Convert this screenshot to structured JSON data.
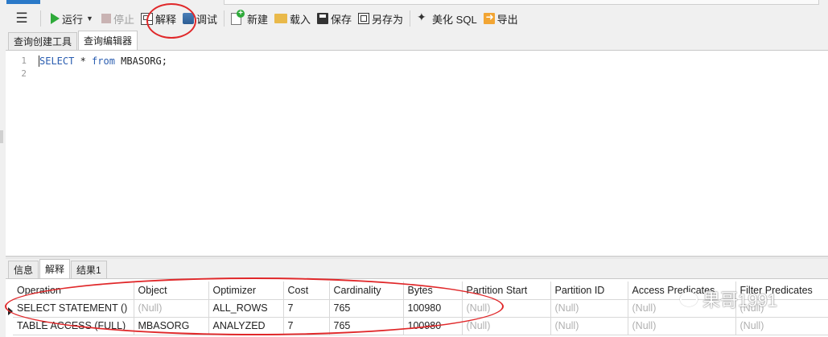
{
  "toolbar": {
    "run": "运行",
    "stop": "停止",
    "explain": "解释",
    "debug": "调试",
    "new": "新建",
    "load": "载入",
    "save": "保存",
    "save_as": "另存为",
    "beautify": "美化 SQL",
    "export": "导出"
  },
  "top_tabs": [
    "查询创建工具",
    "查询编辑器"
  ],
  "editor": {
    "line_numbers": [
      "1",
      "2"
    ],
    "code": {
      "kw1": "SELECT",
      "t1": " * ",
      "kw2": "from",
      "t2": " MBASORG;"
    }
  },
  "bottom_tabs": [
    "信息",
    "解释",
    "结果1"
  ],
  "result": {
    "columns": [
      "Operation",
      "Object",
      "Optimizer",
      "Cost",
      "Cardinality",
      "Bytes",
      "Partition Start",
      "Partition ID",
      "Access Predicates",
      "Filter Predicates"
    ],
    "rows": [
      [
        "SELECT STATEMENT ()",
        "(Null)",
        "ALL_ROWS",
        "7",
        "765",
        "100980",
        "(Null)",
        "(Null)",
        "(Null)",
        "(Null)"
      ],
      [
        "TABLE ACCESS (FULL)",
        "MBASORG",
        "ANALYZED",
        "7",
        "765",
        "100980",
        "(Null)",
        "(Null)",
        "(Null)",
        "(Null)"
      ]
    ]
  },
  "watermark": "果哥1991",
  "colors": {
    "annotation": "#e0282a",
    "keyword": "#2a5db0",
    "run_icon": "#2eaa3a"
  }
}
